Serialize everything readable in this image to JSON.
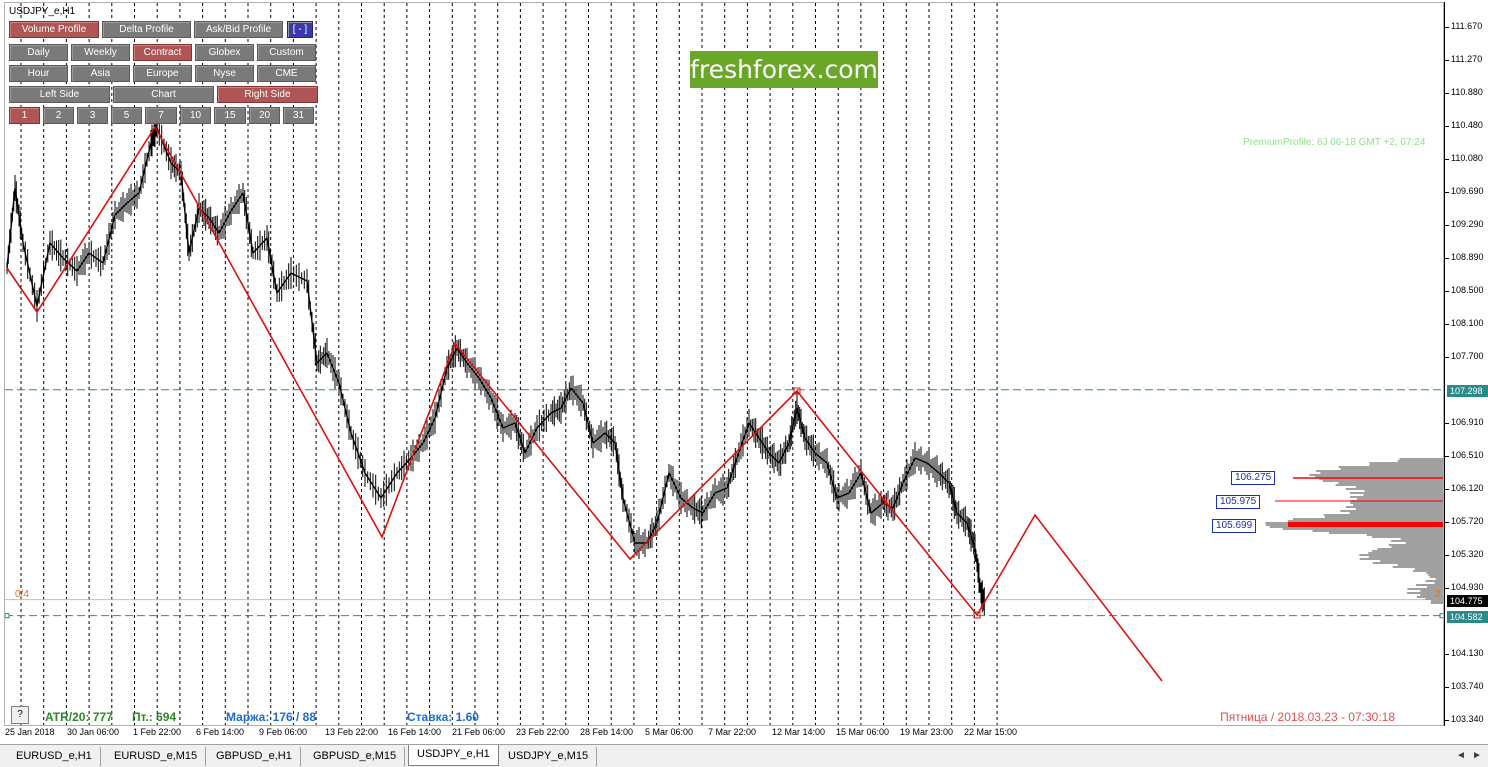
{
  "window": {
    "symbol_title": "USDJPY_e,H1"
  },
  "panel": {
    "row1": [
      {
        "label": "Volume Profile",
        "active": true
      },
      {
        "label": "Delta Profile",
        "active": false
      },
      {
        "label": "Ask/Bid Profile",
        "active": false
      },
      {
        "label": "[ - ]",
        "active": false,
        "blue": true
      }
    ],
    "row2": [
      {
        "label": "Daily",
        "active": false
      },
      {
        "label": "Weekly",
        "active": false
      },
      {
        "label": "Contract",
        "active": true
      },
      {
        "label": "Globex",
        "active": false
      },
      {
        "label": "Custom",
        "active": false
      }
    ],
    "row3": [
      {
        "label": "Hour",
        "active": false
      },
      {
        "label": "Asia",
        "active": false
      },
      {
        "label": "Europe",
        "active": false
      },
      {
        "label": "Nyse",
        "active": false
      },
      {
        "label": "CME",
        "active": false
      }
    ],
    "row4": [
      {
        "label": "Left Side",
        "active": false
      },
      {
        "label": "Chart",
        "active": false
      },
      {
        "label": "Right Side",
        "active": true
      }
    ],
    "row5": [
      {
        "label": "1",
        "active": true
      },
      {
        "label": "2",
        "active": false
      },
      {
        "label": "3",
        "active": false
      },
      {
        "label": "5",
        "active": false
      },
      {
        "label": "7",
        "active": false
      },
      {
        "label": "10",
        "active": false
      },
      {
        "label": "15",
        "active": false
      },
      {
        "label": "20",
        "active": false
      },
      {
        "label": "31",
        "active": false
      }
    ]
  },
  "logo_text": "freshforex.com",
  "premium_label": "PremiumProfile:  6J 06-18 GMT +2, 07:24",
  "price_axis": [
    "111.670",
    "111.270",
    "110.880",
    "110.480",
    "110.080",
    "109.690",
    "109.290",
    "108.890",
    "108.500",
    "108.100",
    "107.700",
    "107.298",
    "106.910",
    "106.510",
    "106.120",
    "105.720",
    "105.320",
    "104.930",
    "104.775",
    "104.582",
    "104.130",
    "103.740",
    "103.340"
  ],
  "price_badges": {
    "level_high": {
      "text": "107.298",
      "color": "#2a8a8a"
    },
    "current": {
      "text": "104.775",
      "color": "#000000"
    },
    "level_low": {
      "text": "104.582",
      "color": "#2a8a8a"
    }
  },
  "profile_levels": [
    "106.275",
    "105.975",
    "105.699"
  ],
  "ratio_left": "0/4",
  "ratio_right": "2",
  "time_axis": [
    "25 Jan 2018",
    "30 Jan 06:00",
    "1 Feb 22:00",
    "6 Feb 14:00",
    "9 Feb 06:00",
    "13 Feb 22:00",
    "16 Feb 14:00",
    "21 Feb 06:00",
    "23 Feb 22:00",
    "28 Feb 14:00",
    "5 Mar 06:00",
    "7 Mar 22:00",
    "12 Mar 14:00",
    "15 Mar 06:00",
    "19 Mar 23:00",
    "22 Mar 15:00"
  ],
  "footer": {
    "help": "?",
    "atr": "ATR/20: 777",
    "pt": "Пт.: 694",
    "margin": "Маржа: 176 / 88",
    "rate": "Ставка: 1.60",
    "date": "Пятница  /  2018.03.23  -  07:30:18"
  },
  "colors": {
    "zigzag": "#e01010",
    "price_line": "#000000",
    "profile": "#a0a0a0",
    "poc": "#ff0000",
    "level_line": "#2a8a8a",
    "atr": "#2a8a2a",
    "pt": "#2a8a2a",
    "margin": "#1d6dd0",
    "rate": "#1d6dd0"
  },
  "tabs": [
    {
      "label": "EURUSD_e,H1",
      "active": false
    },
    {
      "label": "EURUSD_e,M15",
      "active": false
    },
    {
      "label": "GBPUSD_e,H1",
      "active": false
    },
    {
      "label": "GBPUSD_e,M15",
      "active": false
    },
    {
      "label": "USDJPY_e,H1",
      "active": true
    },
    {
      "label": "USDJPY_e,M15",
      "active": false
    }
  ],
  "tab_nav": [
    "◄",
    "►"
  ]
}
